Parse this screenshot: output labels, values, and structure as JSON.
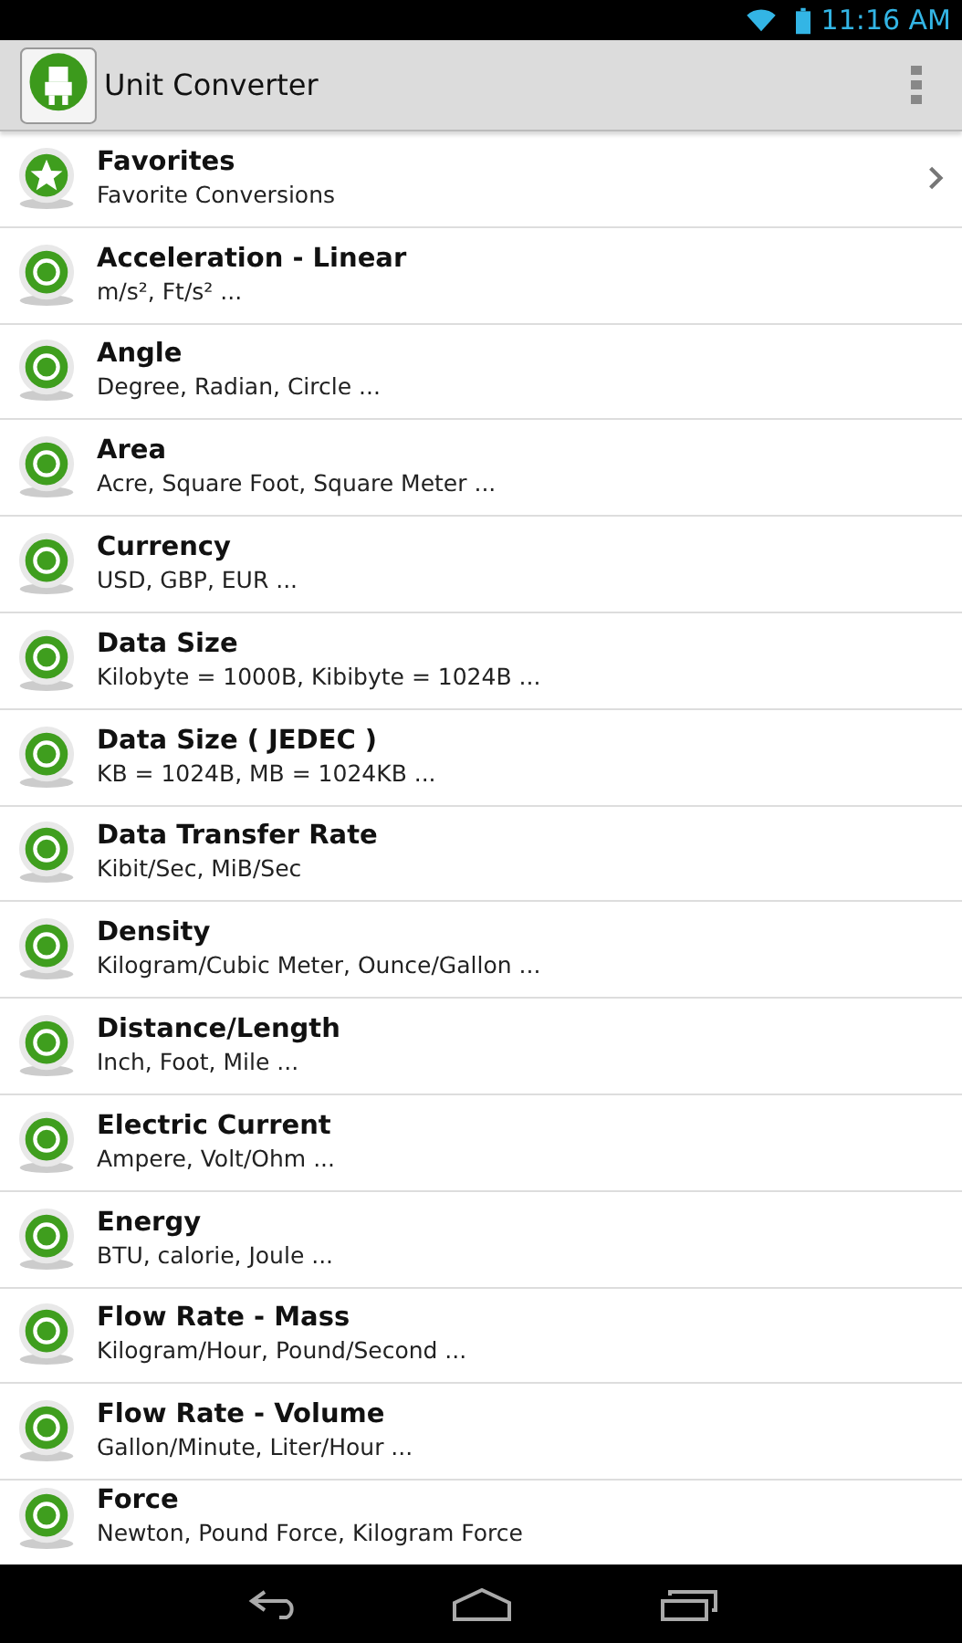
{
  "status_bar": {
    "time": "11:16 AM"
  },
  "action_bar": {
    "title": "Unit Converter"
  },
  "items": [
    {
      "kind": "favorite",
      "title": "Favorites",
      "subtitle": "Favorite Conversions",
      "chevron": true
    },
    {
      "kind": "unit",
      "title": "Acceleration - Linear",
      "subtitle": "m/s², Ft/s² ...",
      "chevron": false
    },
    {
      "kind": "unit",
      "title": "Angle",
      "subtitle": "Degree, Radian, Circle ...",
      "chevron": false
    },
    {
      "kind": "unit",
      "title": "Area",
      "subtitle": "Acre, Square Foot, Square Meter ...",
      "chevron": false
    },
    {
      "kind": "unit",
      "title": "Currency",
      "subtitle": "USD, GBP, EUR ...",
      "chevron": false
    },
    {
      "kind": "unit",
      "title": "Data Size",
      "subtitle": "Kilobyte = 1000B, Kibibyte = 1024B ...",
      "chevron": false
    },
    {
      "kind": "unit",
      "title": "Data Size ( JEDEC )",
      "subtitle": "KB = 1024B, MB = 1024KB ...",
      "chevron": false
    },
    {
      "kind": "unit",
      "title": "Data Transfer Rate",
      "subtitle": "Kibit/Sec, MiB/Sec",
      "chevron": false
    },
    {
      "kind": "unit",
      "title": "Density",
      "subtitle": "Kilogram/Cubic Meter, Ounce/Gallon ...",
      "chevron": false
    },
    {
      "kind": "unit",
      "title": "Distance/Length",
      "subtitle": "Inch, Foot, Mile ...",
      "chevron": false
    },
    {
      "kind": "unit",
      "title": "Electric Current",
      "subtitle": "Ampere, Volt/Ohm ...",
      "chevron": false
    },
    {
      "kind": "unit",
      "title": "Energy",
      "subtitle": "BTU, calorie, Joule ...",
      "chevron": false
    },
    {
      "kind": "unit",
      "title": "Flow Rate - Mass",
      "subtitle": "Kilogram/Hour, Pound/Second ...",
      "chevron": false
    },
    {
      "kind": "unit",
      "title": "Flow Rate - Volume",
      "subtitle": "Gallon/Minute, Liter/Hour ...",
      "chevron": false
    },
    {
      "kind": "unit",
      "title": "Force",
      "subtitle": "Newton, Pound Force, Kilogram Force",
      "chevron": false
    }
  ]
}
